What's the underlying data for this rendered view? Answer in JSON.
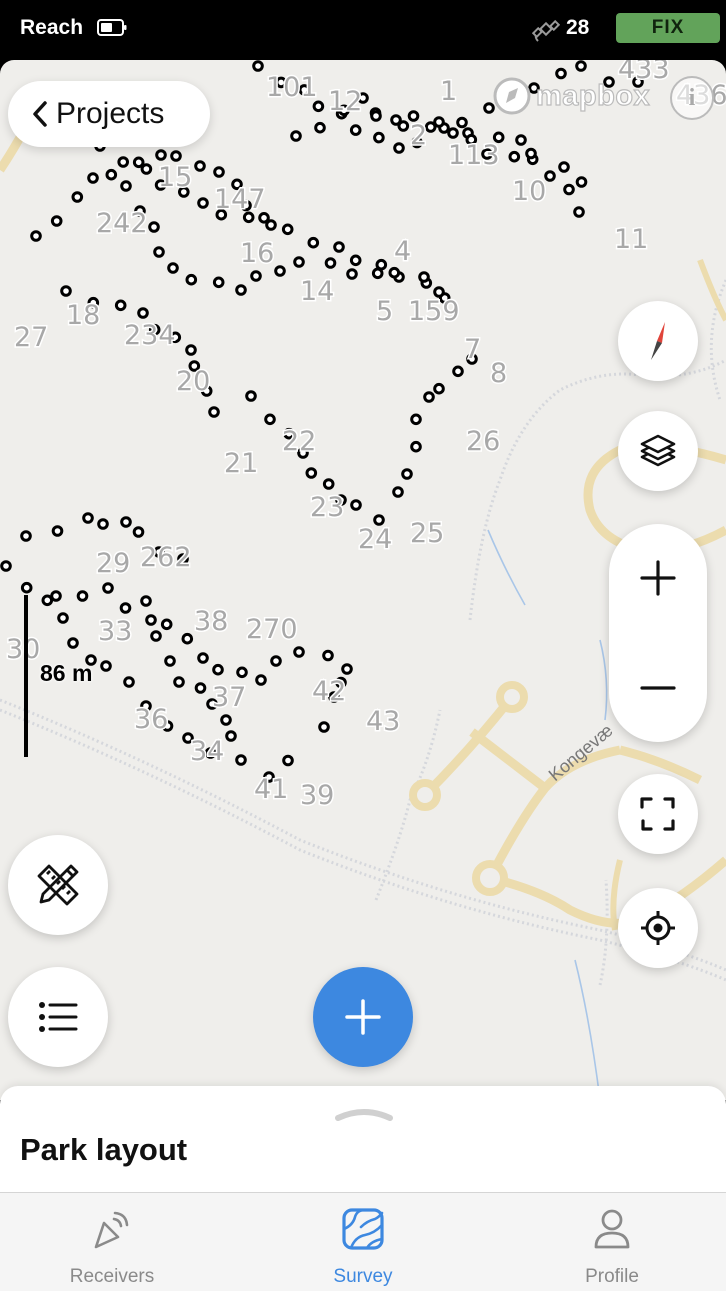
{
  "status_bar": {
    "app_name": "Reach",
    "satellite_count": "28",
    "fix_status": "FIX",
    "fix_color": "#62a35a"
  },
  "header": {
    "back_label": "Projects"
  },
  "map": {
    "attribution": "mapbox",
    "scale_label": "86 m",
    "road_label": "Kongevæ",
    "point_labels": [
      "101",
      "12",
      "1",
      "433",
      "436",
      "2",
      "113",
      "10",
      "11",
      "15",
      "147",
      "242",
      "16",
      "4",
      "14",
      "5",
      "159",
      "7",
      "8",
      "27",
      "18",
      "234",
      "20",
      "26",
      "21",
      "22",
      "23",
      "24",
      "25",
      "29",
      "262",
      "33",
      "38",
      "270",
      "30",
      "42",
      "37",
      "36",
      "34",
      "43",
      "41",
      "39"
    ],
    "controls": {
      "compass": "compass-icon",
      "layers": "layers-icon",
      "zoom_in": "plus-icon",
      "zoom_out": "minus-icon",
      "fit_bounds": "fullscreen-icon",
      "locate": "crosshair-icon",
      "tools": "ruler-pencil-icon",
      "list": "list-icon",
      "add": "plus-icon"
    }
  },
  "sheet": {
    "title": "Park layout"
  },
  "tabs": [
    {
      "label": "Receivers",
      "icon": "receiver-icon",
      "active": false
    },
    {
      "label": "Survey",
      "icon": "survey-icon",
      "active": true
    },
    {
      "label": "Profile",
      "icon": "person-icon",
      "active": false
    }
  ],
  "colors": {
    "accent": "#3d88e0",
    "inactive": "#8a8a8a"
  }
}
